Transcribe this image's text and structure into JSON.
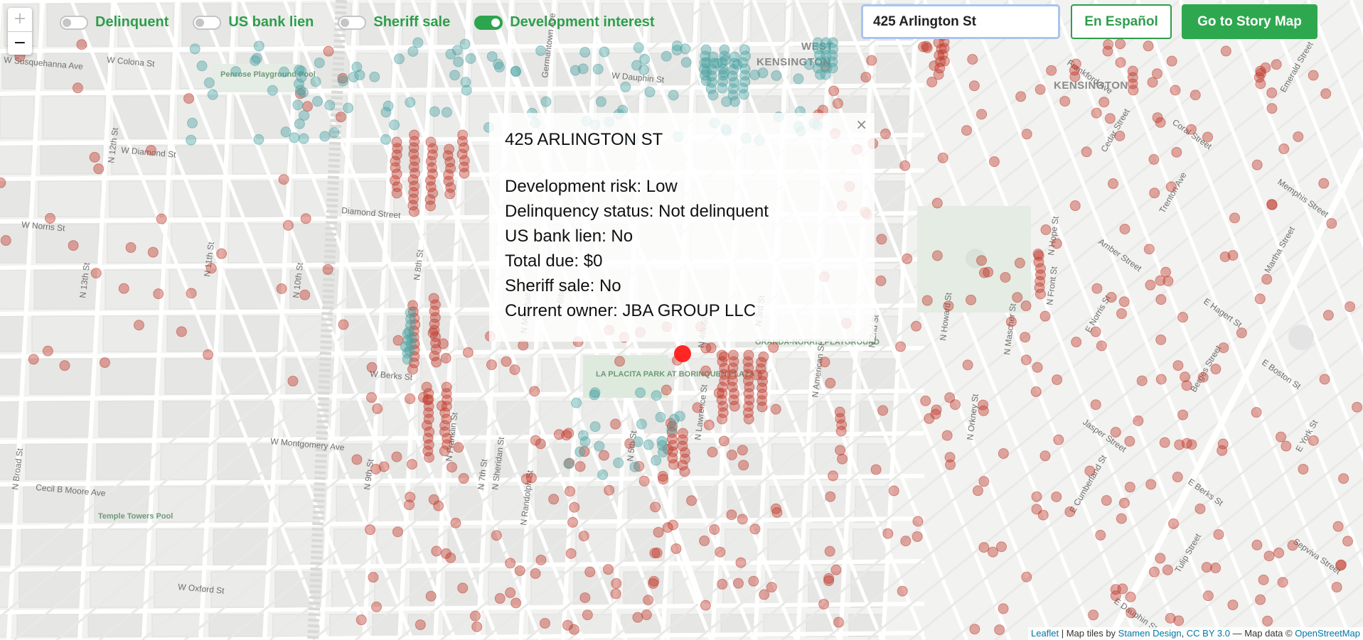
{
  "map": {
    "neighborhoods": [
      "WEST",
      "KENSINGTON",
      "KENSINGTON"
    ],
    "streets": {
      "ns": [
        "N Broad St",
        "N 13th St",
        "N 12th St",
        "N 11th St",
        "N 10th St",
        "N 9th St",
        "N 8th St",
        "N Franklin St",
        "N 7th St",
        "N Marshall St",
        "N 6th St",
        "N 5th St",
        "N 4th St",
        "N 3rd St",
        "N American St",
        "N 2nd St",
        "N Howard St",
        "N Mascher St",
        "N Front St",
        "N Hope St",
        "N Orkney St",
        "N Randolph St",
        "N Sheridan St",
        "N Lawrence St",
        "Germantown Ave"
      ],
      "ew": [
        "W Susquehanna Ave",
        "W Dauphin St",
        "W Diamond St",
        "W Norris St",
        "W Berks St",
        "W Montgomery Ave",
        "Cecil B Moore Ave",
        "W Oxford St",
        "W Colona St",
        "Diamond Street"
      ],
      "diag": [
        "Frankford Ave",
        "Trenton Ave",
        "E Boston St",
        "E Cumberland St",
        "Coral Street",
        "Martha Street",
        "Jasper Street",
        "Tulip Street",
        "Memphis Street",
        "E Norris St",
        "E Berks St",
        "Emerald Street",
        "Amber Street",
        "Berges Street",
        "Sepviva Street",
        "Cedar Street",
        "E Hagert St",
        "E York St",
        "E Dauphin St"
      ]
    },
    "parks": [
      "Penrose Playground Pool",
      "Temple Towers Pool",
      "LA PLACITA PARK AT BORINQUEN PLAZA",
      "ORANDA-NORRIS PLAYGROUND"
    ],
    "colors": {
      "delinquent": "#c0392b",
      "development": "#4aa3a1",
      "selected": "#ff1a1a",
      "accent": "#2e9e4c"
    }
  },
  "zoom": {
    "in_label": "+",
    "out_label": "−"
  },
  "toggles": [
    {
      "label": "Delinquent",
      "on": false
    },
    {
      "label": "US bank lien",
      "on": false
    },
    {
      "label": "Sheriff sale",
      "on": false
    },
    {
      "label": "Development interest",
      "on": true
    }
  ],
  "search": {
    "value": "425 Arlington St"
  },
  "buttons": {
    "spanish": "En Español",
    "story_map": "Go to Story Map"
  },
  "popup": {
    "close": "×",
    "title": "425 ARLINGTON ST",
    "rows": [
      "Development risk: Low",
      "Delinquency status: Not delinquent",
      "US bank lien: No",
      "Total due: $0",
      "Sheriff sale: No",
      "Current owner: JBA GROUP LLC"
    ]
  },
  "attribution": {
    "leaflet": "Leaflet",
    "sep1": " | Map tiles by ",
    "stamen": "Stamen Design",
    "sep2": ", ",
    "license": "CC BY 3.0",
    "sep3": " — Map data © ",
    "osm": "OpenStreetMap"
  }
}
